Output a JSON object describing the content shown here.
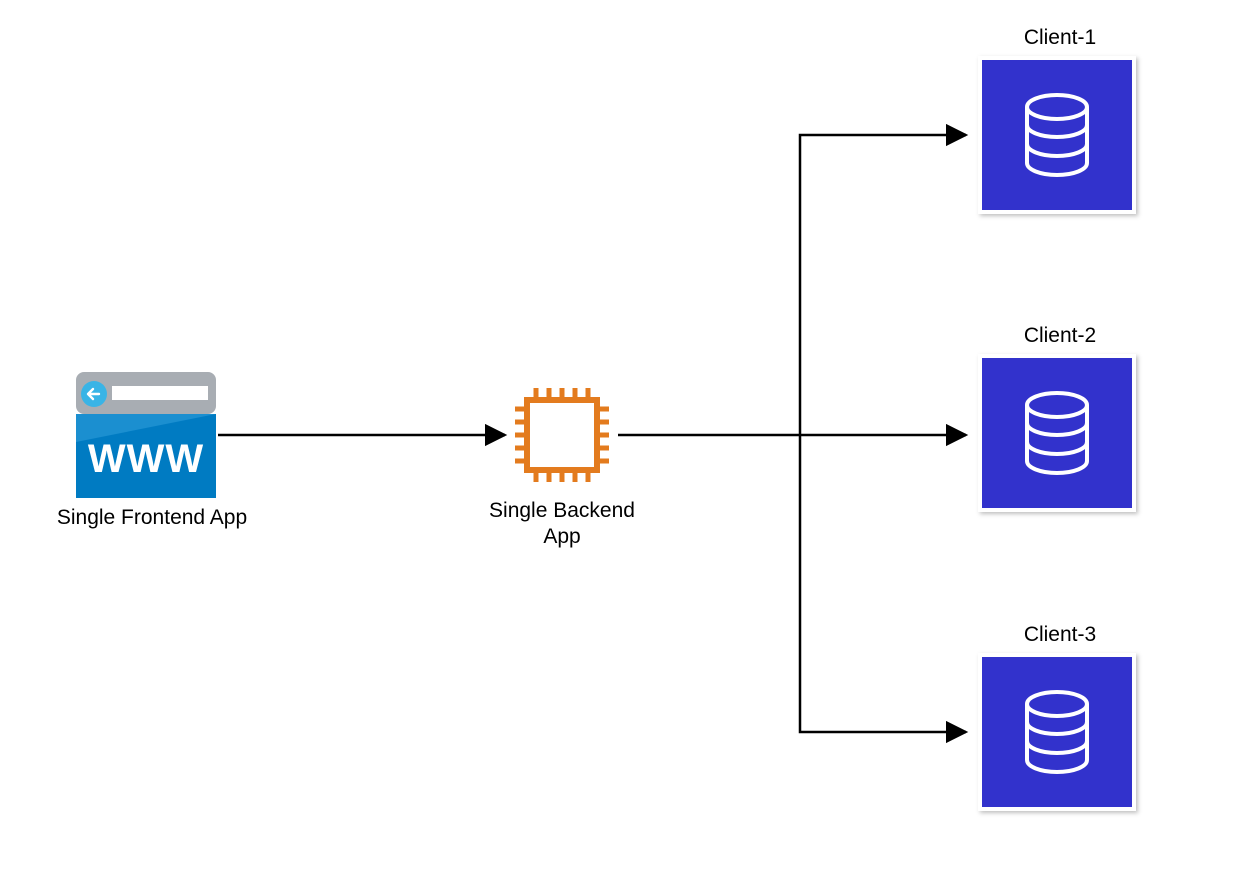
{
  "nodes": {
    "frontend": {
      "label": "Single Frontend App"
    },
    "backend": {
      "label": "Single Backend\nApp"
    },
    "client1": {
      "label": "Client-1"
    },
    "client2": {
      "label": "Client-2"
    },
    "client3": {
      "label": "Client-3"
    }
  },
  "icons": {
    "frontend_www": "WWW",
    "database": "database-icon",
    "cpu": "cpu-chip-icon",
    "browser": "browser-www-icon"
  },
  "colors": {
    "browser_top": "#a8adb3",
    "browser_body": "#007bc2",
    "browser_accent": "#39b4e6",
    "cpu_stroke": "#e37b1e",
    "db_fill": "#3333cc",
    "arrow": "#000000"
  }
}
